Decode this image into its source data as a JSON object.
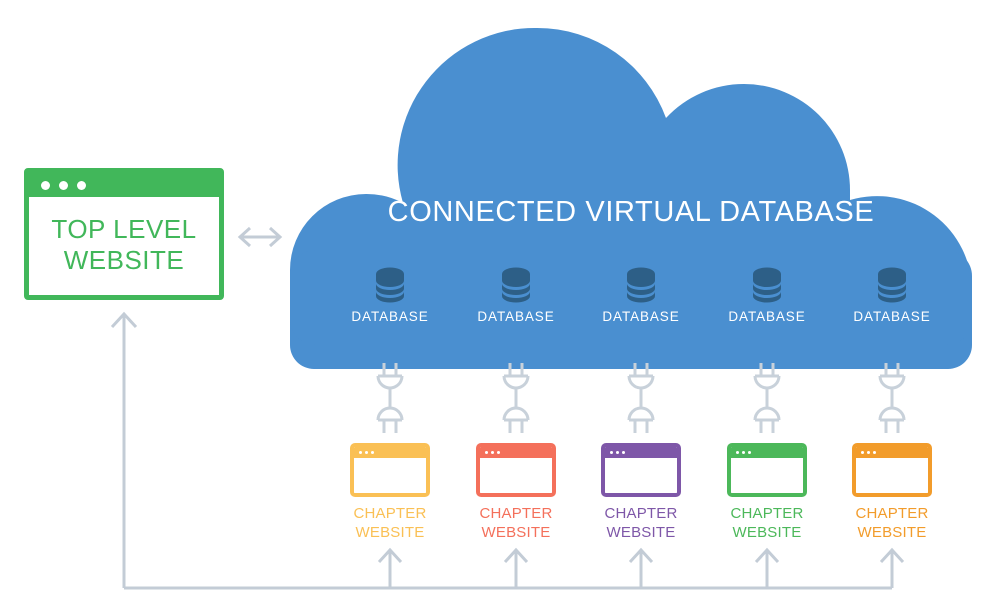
{
  "diagram": {
    "title": "Connected Virtual Database architecture",
    "colors": {
      "cloud": "#4a8fd0",
      "cloud_title_text": "#ffffff",
      "database_icon": "#2d5f87",
      "database_label": "#ffffff",
      "top_level_green": "#41b75a",
      "arrow_gray": "#c3ccd6",
      "plug_gray": "#c8d1da",
      "background": "#ffffff"
    }
  },
  "top_level": {
    "line1": "TOP LEVEL",
    "line2": "WEBSITE",
    "window_dots": 3,
    "color": "#41b75a"
  },
  "link_arrow": {
    "icon": "double-headed-horizontal-arrow",
    "color": "#c3ccd6"
  },
  "cloud": {
    "title": "CONNECTED VIRTUAL DATABASE",
    "fill": "#4a8fd0",
    "databases": [
      {
        "label": "DATABASE",
        "icon": "database-cylinder-icon"
      },
      {
        "label": "DATABASE",
        "icon": "database-cylinder-icon"
      },
      {
        "label": "DATABASE",
        "icon": "database-cylinder-icon"
      },
      {
        "label": "DATABASE",
        "icon": "database-cylinder-icon"
      },
      {
        "label": "DATABASE",
        "icon": "database-cylinder-icon"
      }
    ]
  },
  "connectors": [
    {
      "icon": "plug-socket-icon",
      "color": "#c8d1da"
    },
    {
      "icon": "plug-socket-icon",
      "color": "#c8d1da"
    },
    {
      "icon": "plug-socket-icon",
      "color": "#c8d1da"
    },
    {
      "icon": "plug-socket-icon",
      "color": "#c8d1da"
    },
    {
      "icon": "plug-socket-icon",
      "color": "#c8d1da"
    }
  ],
  "chapters": [
    {
      "line1": "CHAPTER",
      "line2": "WEBSITE",
      "color": "#fac055"
    },
    {
      "line1": "CHAPTER",
      "line2": "WEBSITE",
      "color": "#f4705b"
    },
    {
      "line1": "CHAPTER",
      "line2": "WEBSITE",
      "color": "#7e57a8"
    },
    {
      "line1": "CHAPTER",
      "line2": "WEBSITE",
      "color": "#4cb85a"
    },
    {
      "line1": "CHAPTER",
      "line2": "WEBSITE",
      "color": "#f29c2b"
    }
  ],
  "flow": {
    "feedback_arrows": 5,
    "feedback_arrow_color": "#c3ccd6",
    "return_arrow_to_top_level": "up-arrow"
  }
}
